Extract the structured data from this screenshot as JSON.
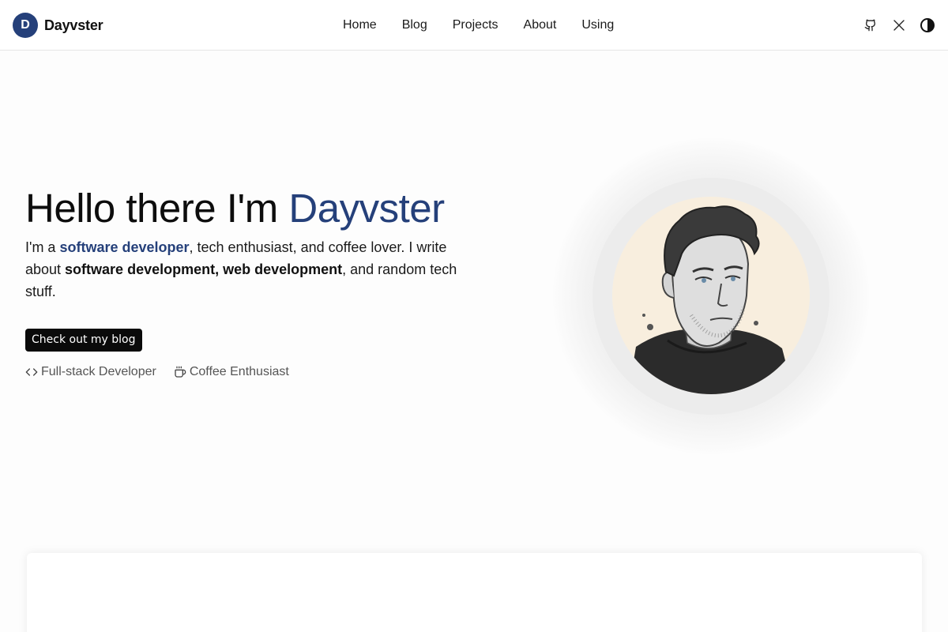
{
  "header": {
    "brand_initial": "D",
    "brand_name": "Dayvster",
    "nav": [
      "Home",
      "Blog",
      "Projects",
      "About",
      "Using"
    ],
    "icons": [
      "github-icon",
      "x-icon",
      "theme-toggle-icon"
    ]
  },
  "hero": {
    "title_prefix": "Hello there I'm ",
    "title_name": "Dayvster",
    "desc_1": "I'm a ",
    "desc_link": "software developer",
    "desc_2": ", tech enthusiast, and coffee lover. I write about ",
    "desc_strong": "software development, web development",
    "desc_3": ", and random tech stuff.",
    "cta_label": "Check out my blog",
    "tags": [
      "Full-stack Developer",
      "Coffee Enthusiast"
    ],
    "tag_icons": [
      "code-icon",
      "coffee-icon"
    ]
  },
  "colors": {
    "accent": "#25407a",
    "button_bg": "#0a0a0a",
    "portrait_bg": "#f8eede"
  }
}
